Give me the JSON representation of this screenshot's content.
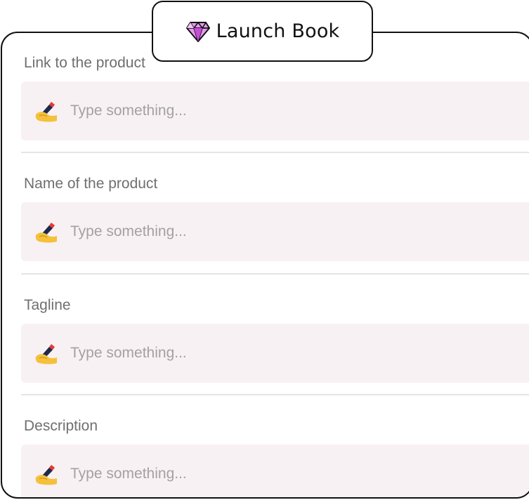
{
  "app": {
    "title": "Launch Book",
    "icon": "gem-icon"
  },
  "form": {
    "fields": [
      {
        "label": "Link to the product",
        "placeholder": "Type something...",
        "icon": "writing-hand-icon"
      },
      {
        "label": "Name of the product",
        "placeholder": "Type something...",
        "icon": "writing-hand-icon"
      },
      {
        "label": "Tagline",
        "placeholder": "Type something...",
        "icon": "writing-hand-icon"
      },
      {
        "label": "Description",
        "placeholder": "Type something...",
        "icon": "writing-hand-icon"
      }
    ]
  },
  "colors": {
    "border": "#111111",
    "input_bg": "#f8f1f3",
    "label": "#6f6f6f",
    "placeholder": "#a3a1a2",
    "gem": "#d46ae0"
  }
}
